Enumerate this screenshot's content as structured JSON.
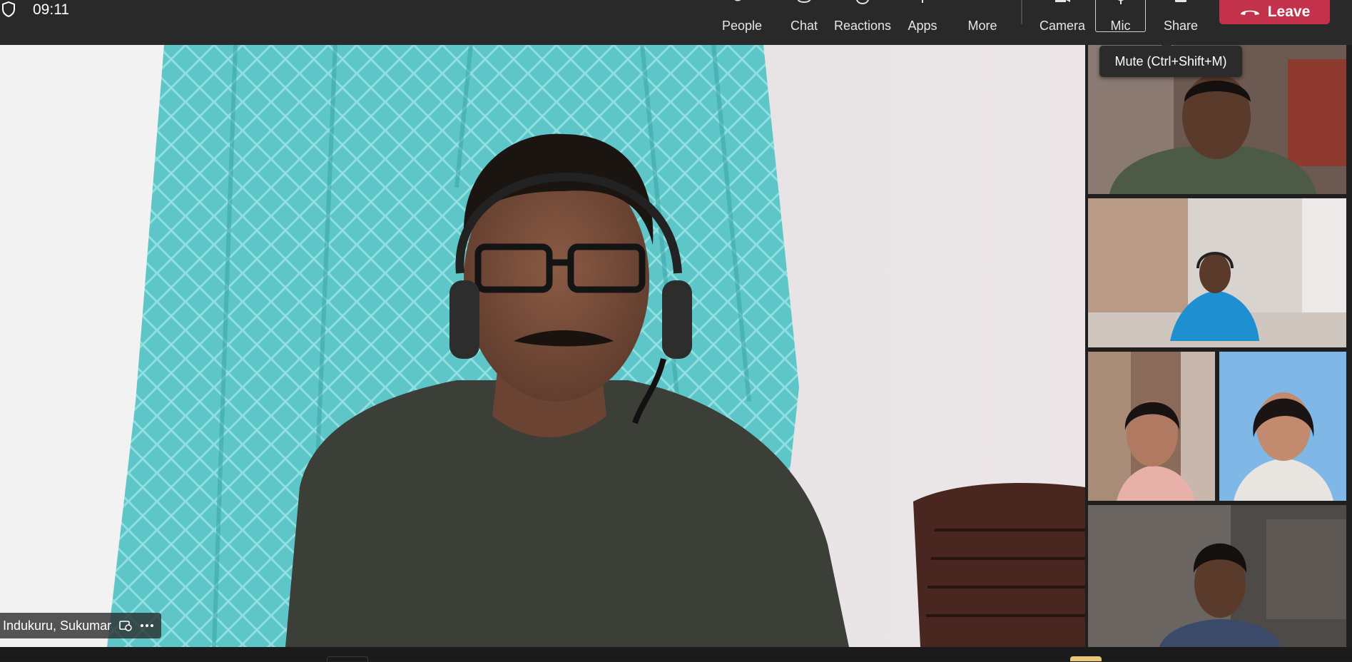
{
  "meeting": {
    "timer": "09:11",
    "colors": {
      "topbar": "#292929",
      "leave": "#c4314b",
      "background": "#1f1f1f"
    }
  },
  "toolbar": {
    "people_label": "People",
    "chat_label": "Chat",
    "reactions_label": "Reactions",
    "apps_label": "Apps",
    "more_label": "More",
    "camera_label": "Camera",
    "mic_label": "Mic",
    "share_label": "Share",
    "leave_label": "Leave"
  },
  "tooltip": {
    "text": "Mute (Ctrl+Shift+M)"
  },
  "main_video": {
    "participant_name": "Indukuru, Sukumar",
    "icons": [
      "pin-icon",
      "more-options-icon"
    ]
  },
  "side_tiles": [
    {
      "id": "tile-1"
    },
    {
      "id": "tile-2"
    },
    {
      "id": "tile-3"
    },
    {
      "id": "tile-4"
    },
    {
      "id": "tile-5"
    }
  ]
}
